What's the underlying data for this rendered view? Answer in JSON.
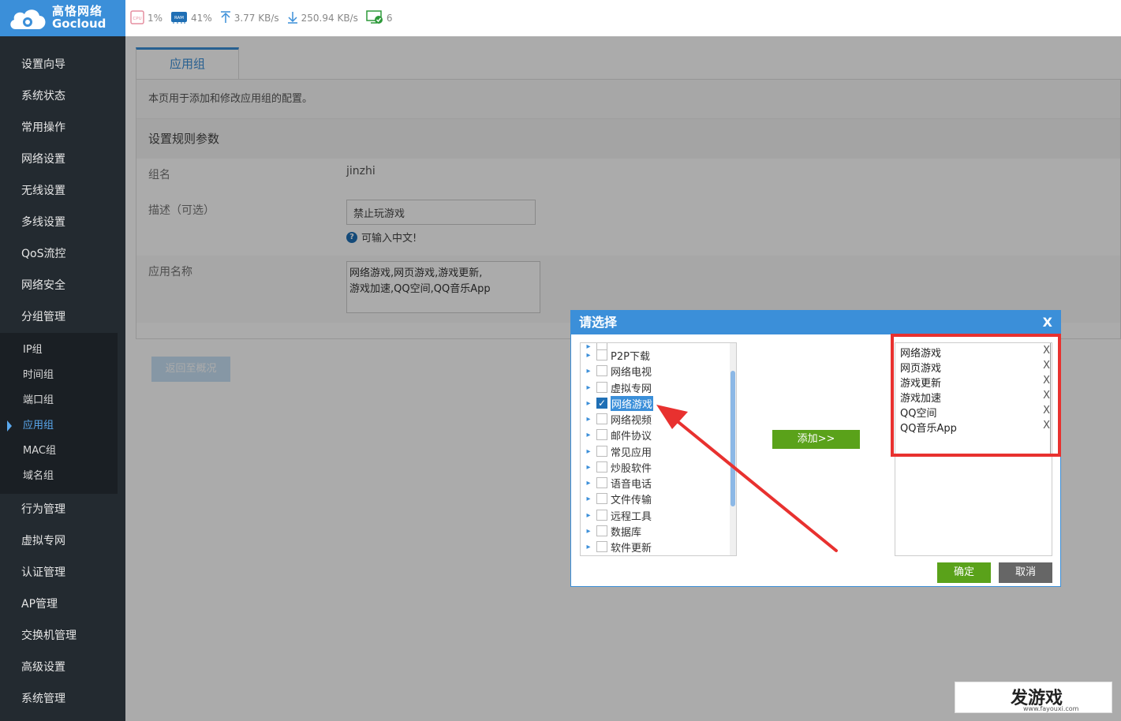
{
  "app": {
    "brand_cn": "高恪网络",
    "brand_en": "Gocloud"
  },
  "status": {
    "cpu_label": "CPU",
    "cpu": "1%",
    "ram_label": "RAM",
    "ram": "41%",
    "upload": "3.77 KB/s",
    "download": "250.94 KB/s",
    "devices": "6"
  },
  "sidebar": {
    "items_top": [
      "设置向导",
      "系统状态",
      "常用操作",
      "网络设置",
      "无线设置",
      "多线设置",
      "QoS流控",
      "网络安全",
      "分组管理"
    ],
    "sub_items": [
      "IP组",
      "时间组",
      "端口组",
      "应用组",
      "MAC组",
      "域名组"
    ],
    "active_sub": "应用组",
    "items_bottom": [
      "行为管理",
      "虚拟专网",
      "认证管理",
      "AP管理",
      "交换机管理",
      "高级设置",
      "系统管理"
    ]
  },
  "page": {
    "tab": "应用组",
    "description": "本页用于添加和修改应用组的配置。",
    "section_title": "设置规则参数",
    "group_name_label": "组名",
    "group_name_value": "jinzhi",
    "desc_label": "描述（可选）",
    "desc_value": "禁止玩游戏",
    "desc_hint": "可输入中文!",
    "app_name_label": "应用名称",
    "app_name_line1": "网络游戏,网页游戏,游戏更新,",
    "app_name_line2": "游戏加速,QQ空间,QQ音乐App",
    "back_button": "返回至概况"
  },
  "dialog": {
    "title": "请选择",
    "close": "X",
    "tree_items": [
      "P2P下载",
      "网络电视",
      "虚拟专网",
      "网络游戏",
      "网络视频",
      "邮件协议",
      "常见应用",
      "炒股软件",
      "语音电话",
      "文件传输",
      "远程工具",
      "数据库",
      "软件更新"
    ],
    "checked_item": "网络游戏",
    "add_button": "添加>>",
    "selected": [
      "网络游戏",
      "网页游戏",
      "游戏更新",
      "游戏加速",
      "QQ空间",
      "QQ音乐App"
    ],
    "remove_mark": "X",
    "ok_button": "确定",
    "cancel_button": "取消"
  },
  "watermark": {
    "title": "发游戏",
    "url": "www.fayouxi.com"
  },
  "colors": {
    "brand_blue": "#3b8fd9",
    "sidebar_bg": "#232a30",
    "green_button": "#5aa21a",
    "annotation_red": "#e8312f"
  }
}
